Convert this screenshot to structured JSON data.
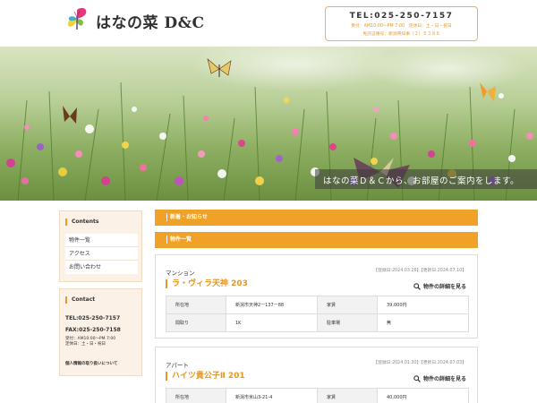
{
  "header": {
    "logo_text": "はなの菜 D&C",
    "tel": "TEL:025-250-7157",
    "hours": "受付：AM10:00〜PM 7:00　定休日：土・日・祝日",
    "license": "免許証番号：新潟県知事（２）５３８６"
  },
  "hero": {
    "caption": "はなの菜Ｄ＆Ｃから、お部屋のご案内をします。"
  },
  "sidebar": {
    "contents_title": "Contents",
    "menu": [
      {
        "label": "物件一覧"
      },
      {
        "label": "アクセス"
      },
      {
        "label": "お問い合わせ"
      }
    ],
    "contact_title": "Contact",
    "tel": "TEL:025-250-7157",
    "fax": "FAX:025-250-7158",
    "hours": "受付：AM10:00〜PM 7:00",
    "holidays": "定休日：土・日・祝日",
    "privacy": "個人情報の取り扱いについて"
  },
  "main": {
    "news_title": "新着・お知らせ",
    "list_title": "物件一覧",
    "detail_label": "物件の詳細を見る",
    "properties": [
      {
        "type": "マンション",
        "dates": "【登録日:2024.03.26】【更新日:2024.07.10】",
        "name": "ラ・ヴィラ天神 203",
        "rows": [
          {
            "k1": "所在地",
            "v1": "新潟市天神2ー137ー88",
            "k2": "家賃",
            "v2": "39,000円"
          },
          {
            "k1": "間取り",
            "v1": "1K",
            "k2": "駐車場",
            "v2": "無"
          }
        ]
      },
      {
        "type": "アパート",
        "dates": "【登録日:2024.01.30】【更新日:2024.07.03】",
        "name": "ハイツ貴公子Ⅱ 201",
        "rows": [
          {
            "k1": "所在地",
            "v1": "新潟市米山3-21-4",
            "k2": "家賃",
            "v2": "40,000円"
          }
        ]
      }
    ]
  },
  "colors": {
    "accent": "#f0a128",
    "title_orange": "#e8961e",
    "sidebar_bg": "#fbf1e6"
  },
  "icons": [
    "butterfly-logo-icon",
    "search-icon"
  ]
}
